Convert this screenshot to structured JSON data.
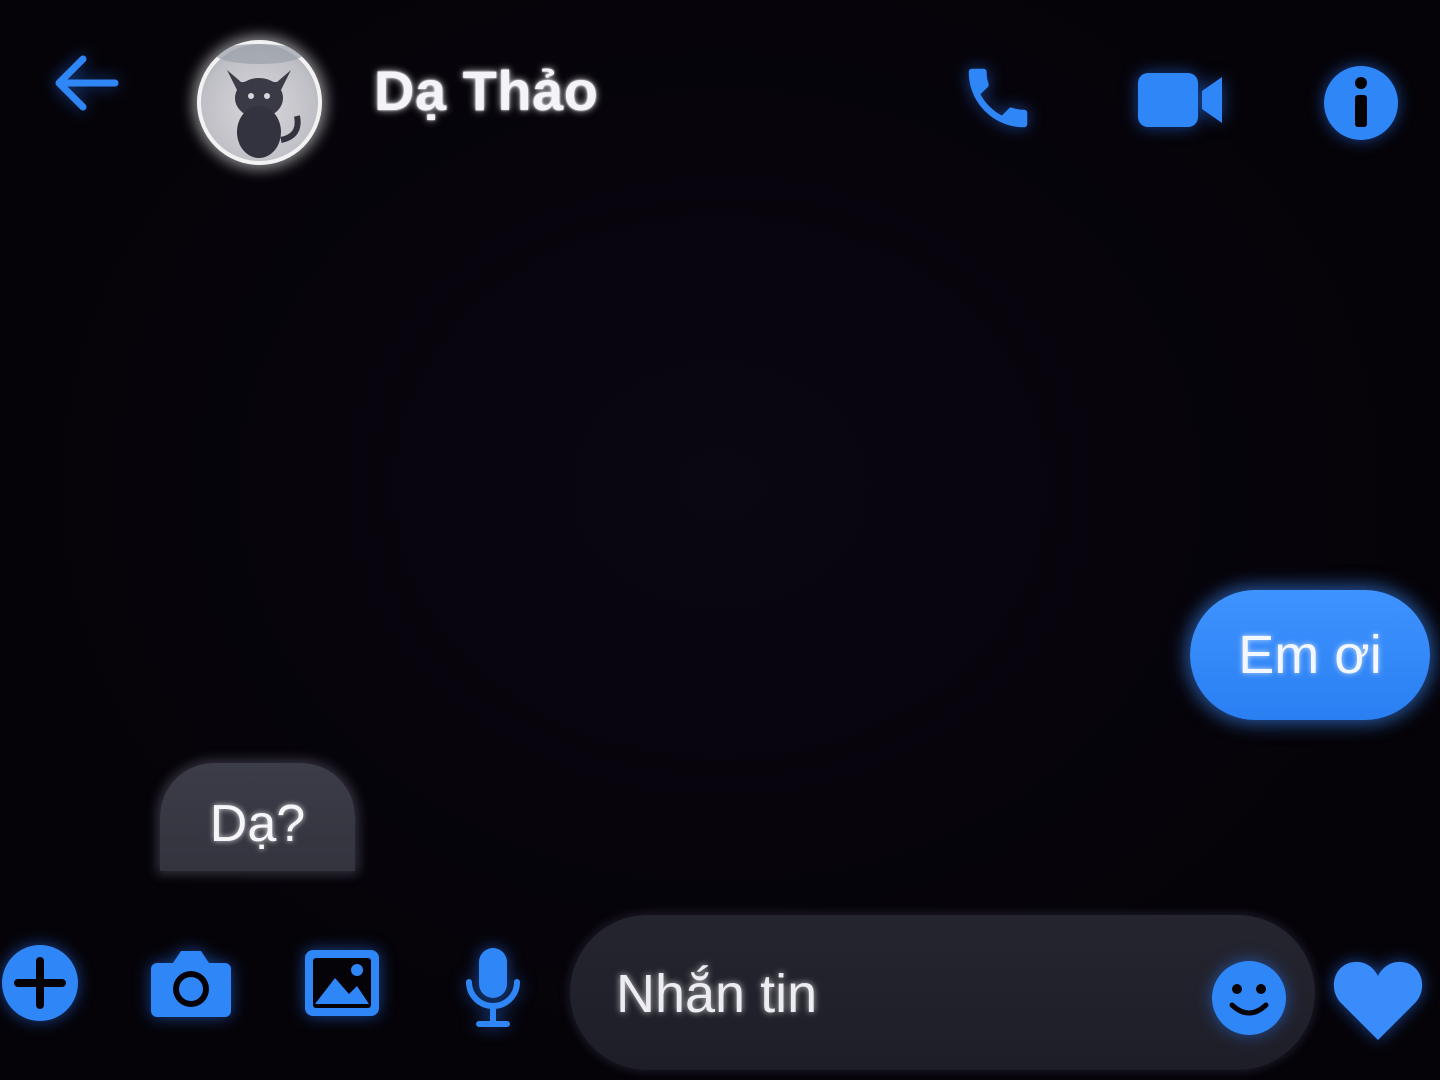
{
  "header": {
    "back_icon": "back-arrow-icon",
    "contact_name": "Dạ Thảo",
    "avatar": "contact-avatar",
    "actions": [
      {
        "icon": "phone-icon",
        "label": "call"
      },
      {
        "icon": "video-camera-icon",
        "label": "video call"
      },
      {
        "icon": "info-icon",
        "label": "info"
      }
    ]
  },
  "messages": [
    {
      "direction": "outgoing",
      "text": "Em ơi"
    },
    {
      "direction": "incoming",
      "text": "Dạ?"
    }
  ],
  "composer": {
    "placeholder": "Nhắn tin",
    "buttons": [
      "plus-icon",
      "camera-icon",
      "image-icon",
      "microphone-icon",
      "emoji-icon",
      "heart-icon"
    ]
  },
  "colors": {
    "accent": "#2f86f6",
    "background": "#050308",
    "incoming_bubble": "#383944",
    "outgoing_bubble": "#3a8cfb"
  }
}
